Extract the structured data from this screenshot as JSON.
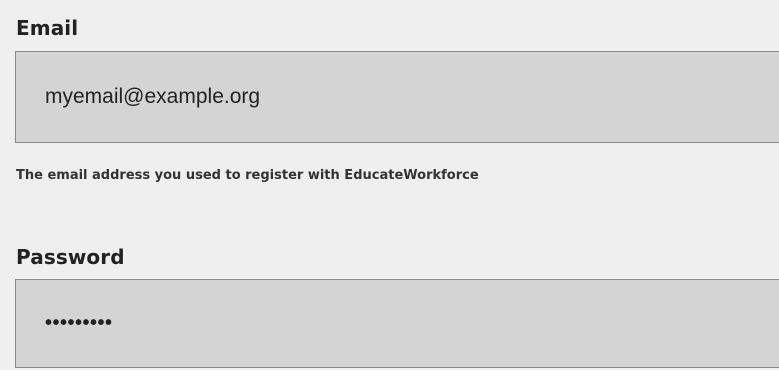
{
  "form": {
    "email": {
      "label": "Email",
      "value": "myemail@example.org",
      "help_text": "The email address you used to register with EducateWorkforce"
    },
    "password": {
      "label": "Password",
      "value_masked": "•••••••••"
    }
  }
}
